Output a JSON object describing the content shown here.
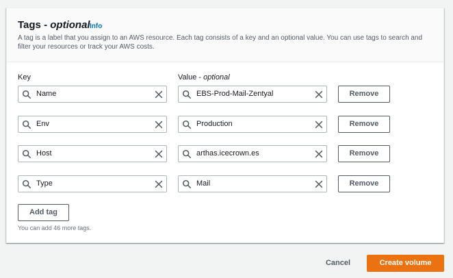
{
  "section": {
    "title": "Tags",
    "title_separator": " - ",
    "title_optional": "optional",
    "info_label": "Info",
    "description": "A tag is a label that you assign to an AWS resource. Each tag consists of a key and an optional value. You can use tags to search and filter your resources or track your AWS costs."
  },
  "columns": {
    "key_label": "Key",
    "value_label": "Value",
    "value_separator": " - ",
    "value_optional": "optional"
  },
  "tags": [
    {
      "key": "Name",
      "value": "EBS-Prod-Mail-Zentyal",
      "remove_label": "Remove"
    },
    {
      "key": "Env",
      "value": "Production",
      "remove_label": "Remove"
    },
    {
      "key": "Host",
      "value": "arthas.icecrown.es",
      "remove_label": "Remove"
    },
    {
      "key": "Type",
      "value": "Mail",
      "remove_label": "Remove"
    }
  ],
  "add_tag_label": "Add tag",
  "remaining_hint": "You can add 46 more tags.",
  "footer": {
    "cancel_label": "Cancel",
    "create_label": "Create volume"
  },
  "colors": {
    "primary_button": "#ec7211",
    "link": "#0073bb",
    "border": "#aab7b8"
  },
  "icons": {
    "field_left": "search-icon",
    "field_right": "clear-icon"
  }
}
